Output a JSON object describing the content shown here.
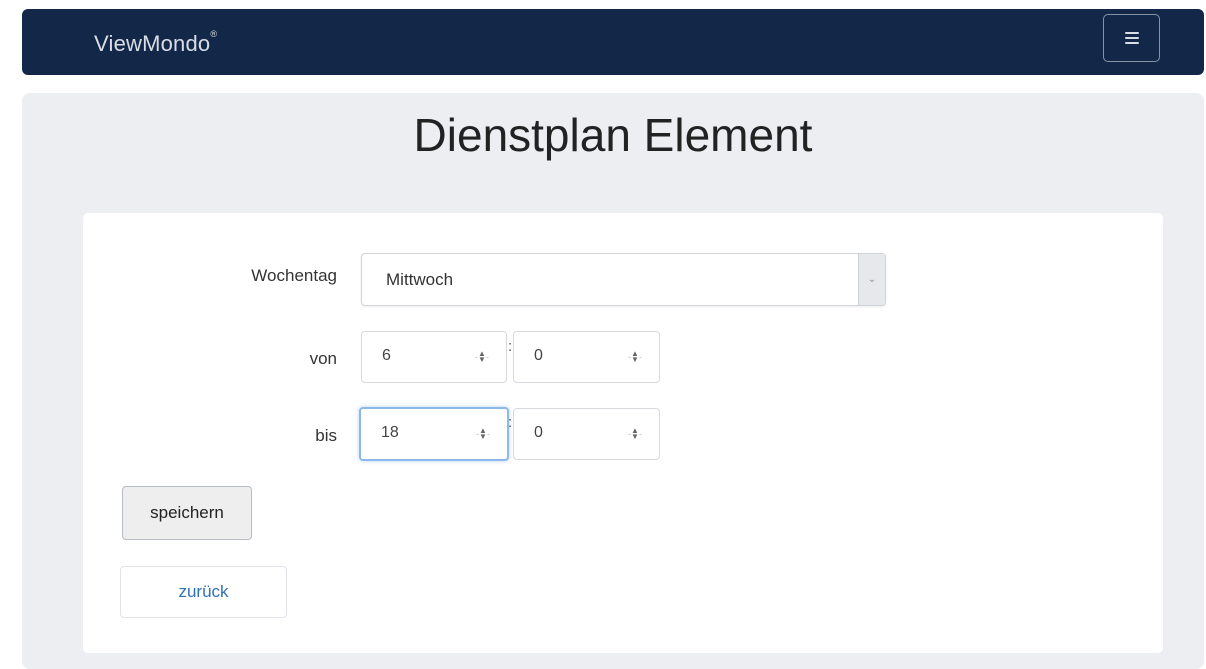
{
  "navbar": {
    "brand": "ViewMondo",
    "brand_mark": "®",
    "menu_icon": "hamburger-menu-icon"
  },
  "page": {
    "title": "Dienstplan Element"
  },
  "form": {
    "weekday_label": "Wochentag",
    "weekday_value": "Mittwoch",
    "from_label": "von",
    "from_hour": "6",
    "from_minute": "0",
    "to_label": "bis",
    "to_hour": "18",
    "to_minute": "0",
    "separator": ":",
    "save_label": "speichern",
    "back_label": "zurück"
  },
  "colors": {
    "navbar_bg": "#132848",
    "jumbotron_bg": "#eceef2",
    "link": "#3070b8",
    "focus": "#8cb8ea"
  }
}
